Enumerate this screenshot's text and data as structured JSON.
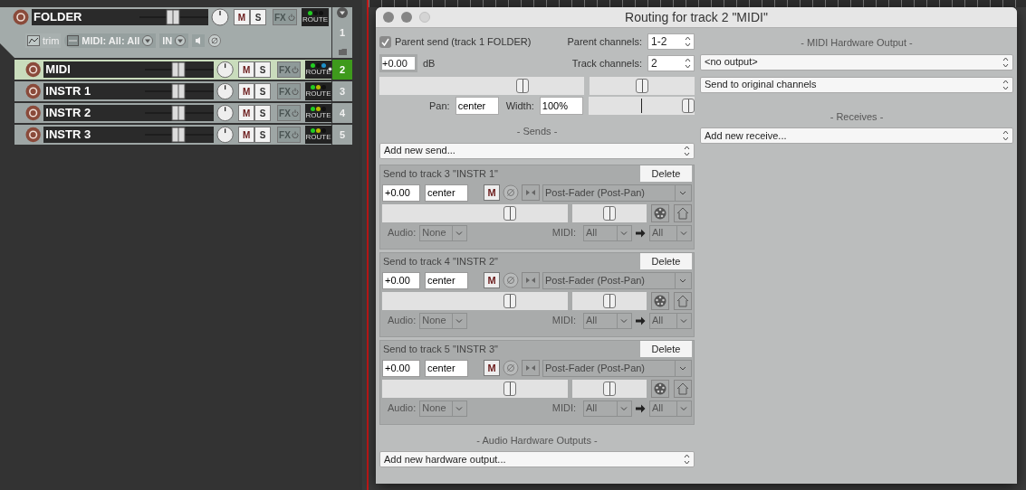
{
  "tracks": [
    {
      "kind": "folder",
      "name": "FOLDER",
      "number": "1",
      "selected": false,
      "buttons": [
        "M",
        "S",
        "FX"
      ],
      "route_label": "ROUTE",
      "leds": [
        {
          "color": "#22cc22"
        },
        {
          "color": "#111111"
        },
        {
          "color": "#111111"
        }
      ],
      "trim": "trim",
      "midi_input": "MIDI: All: All",
      "in_label": "IN"
    },
    {
      "kind": "track",
      "name": "MIDI",
      "number": "2",
      "selected": true,
      "buttons": [
        "M",
        "S",
        "FX"
      ],
      "route_label": "ROUTE",
      "leds": [
        {
          "color": "#22cc22"
        },
        {
          "color": "#111111"
        },
        {
          "color": "#1e90c8"
        }
      ]
    },
    {
      "kind": "track",
      "name": "INSTR 1",
      "number": "3",
      "selected": false,
      "buttons": [
        "M",
        "S",
        "FX"
      ],
      "route_label": "ROUTE",
      "leds": [
        {
          "color": "#22cc22"
        },
        {
          "color": "#b8b800"
        },
        {
          "color": "#111111"
        }
      ]
    },
    {
      "kind": "track",
      "name": "INSTR 2",
      "number": "4",
      "selected": false,
      "buttons": [
        "M",
        "S",
        "FX"
      ],
      "route_label": "ROUTE",
      "leds": [
        {
          "color": "#22cc22"
        },
        {
          "color": "#b8b800"
        },
        {
          "color": "#111111"
        }
      ]
    },
    {
      "kind": "track",
      "name": "INSTR 3",
      "number": "5",
      "selected": false,
      "buttons": [
        "M",
        "S",
        "FX"
      ],
      "route_label": "ROUTE",
      "leds": [
        {
          "color": "#22cc22"
        },
        {
          "color": "#b8b800"
        },
        {
          "color": "#111111"
        }
      ]
    }
  ],
  "dialog": {
    "title": "Routing for track 2 \"MIDI\"",
    "parent_send": {
      "label": "Parent send (track 1 FOLDER)",
      "checked": true
    },
    "parent_channels": {
      "label": "Parent channels:",
      "value": "1-2"
    },
    "volume": {
      "value": "+0.00",
      "unit": "dB",
      "level": 0.7
    },
    "track_channels": {
      "label": "Track channels:",
      "value": "2"
    },
    "pan": {
      "label": "Pan:",
      "value": "center",
      "level": 0.5
    },
    "width": {
      "label": "Width:",
      "value": "100%",
      "level": 0.94
    },
    "sends_heading": "-  Sends  -",
    "add_send": "Add new send...",
    "sends": [
      {
        "title": "Send to track 3 \"INSTR 1\"",
        "delete": "Delete",
        "volume": {
          "value": "+0.00",
          "level": 0.69
        },
        "pan": {
          "value": "center",
          "level": 0.5
        },
        "mute": "M",
        "mode": "Post-Fader (Post-Pan)",
        "audio_label": "Audio:",
        "audio": "None",
        "midi_label": "MIDI:",
        "midi_src": "All",
        "midi_dst": "All"
      },
      {
        "title": "Send to track 4 \"INSTR 2\"",
        "delete": "Delete",
        "volume": {
          "value": "+0.00",
          "level": 0.69
        },
        "pan": {
          "value": "center",
          "level": 0.5
        },
        "mute": "M",
        "mode": "Post-Fader (Post-Pan)",
        "audio_label": "Audio:",
        "audio": "None",
        "midi_label": "MIDI:",
        "midi_src": "All",
        "midi_dst": "All"
      },
      {
        "title": "Send to track 5 \"INSTR 3\"",
        "delete": "Delete",
        "volume": {
          "value": "+0.00",
          "level": 0.69
        },
        "pan": {
          "value": "center",
          "level": 0.5
        },
        "mute": "M",
        "mode": "Post-Fader (Post-Pan)",
        "audio_label": "Audio:",
        "audio": "None",
        "midi_label": "MIDI:",
        "midi_src": "All",
        "midi_dst": "All"
      }
    ],
    "audio_hw_heading": "-  Audio Hardware Outputs  -",
    "add_hw_output": "Add new hardware output...",
    "midi_hw_heading": "-  MIDI Hardware Output  -",
    "midi_output": "<no output>",
    "midi_channels": "Send to original channels",
    "receives_heading": "-  Receives  -",
    "add_receive": "Add new receive..."
  }
}
